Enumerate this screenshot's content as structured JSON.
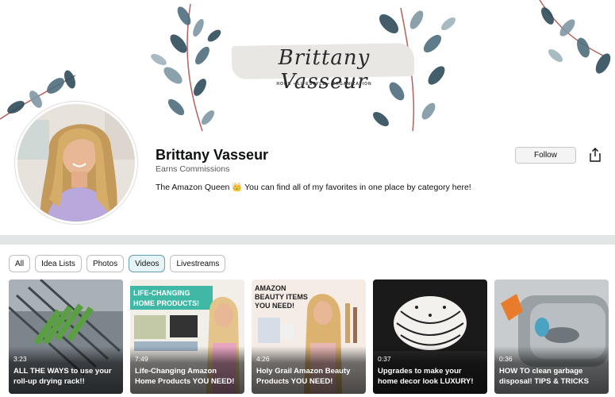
{
  "banner": {
    "title": "Brittany Vasseur",
    "tagline": "HOME • LIFESTYLE • ORGANIZATION"
  },
  "profile": {
    "name": "Brittany Vasseur",
    "subline": "Earns Commissions",
    "bio": "The Amazon Queen 👑 You can find all of my favorites in one place by category here!",
    "follow_label": "Follow"
  },
  "filters": [
    {
      "label": "All",
      "active": false
    },
    {
      "label": "Idea Lists",
      "active": false
    },
    {
      "label": "Photos",
      "active": false
    },
    {
      "label": "Videos",
      "active": true
    },
    {
      "label": "Livestreams",
      "active": false
    }
  ],
  "videos": [
    {
      "duration": "3:23",
      "title": "ALL THE WAYS to use your roll-up drying rack!!"
    },
    {
      "duration": "7:49",
      "title": "Life-Changing Amazon Home Products YOU NEED!",
      "thumb_text": "LIFE-CHANGING HOME PRODUCTS!"
    },
    {
      "duration": "4:26",
      "title": "Holy Grail Amazon Beauty Products YOU NEED!",
      "thumb_text": "AMAZON BEAUTY ITEMS YOU NEED!"
    },
    {
      "duration": "0:37",
      "title": "Upgrades to make your home decor look LUXURY!"
    },
    {
      "duration": "0:36",
      "title": "HOW TO clean garbage disposal! TIPS & TRICKS"
    }
  ],
  "colors": {
    "leaf": "#4f6e7e",
    "stem": "#b5605a",
    "active_chip_bg": "#e7f4f7",
    "divider": "#e3e6e6"
  }
}
